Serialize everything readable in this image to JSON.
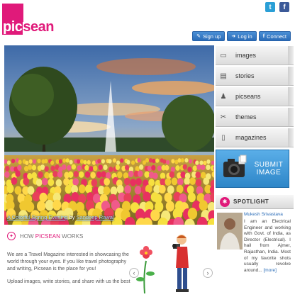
{
  "brand": {
    "logo_text": "picsean",
    "logo_prefix": "pic",
    "logo_suffix": "sean",
    "accent": "#e01a7a"
  },
  "social": {
    "twitter_icon": "twitter-icon",
    "facebook_icon": "facebook-icon",
    "twitter_glyph": "t",
    "facebook_glyph": "f"
  },
  "auth": {
    "signup": "Sign up",
    "login": "Log in",
    "connect": "Connect"
  },
  "hero": {
    "caption_title": "A Colorful Spring Evening",
    "caption_by": "by",
    "caption_author": "Sandeep Rawal"
  },
  "menu": [
    {
      "label": "images",
      "icon": "monitor-icon",
      "glyph": "▭"
    },
    {
      "label": "stories",
      "icon": "document-icon",
      "glyph": "▤"
    },
    {
      "label": "picseans",
      "icon": "person-icon",
      "glyph": "♟"
    },
    {
      "label": "themes",
      "icon": "scissors-icon",
      "glyph": "✂"
    },
    {
      "label": "magazines",
      "icon": "book-icon",
      "glyph": "▯"
    }
  ],
  "submit": {
    "line1": "SUBMIT",
    "line2": "IMAGE"
  },
  "spotlight": {
    "heading": "SPOTLIGHT",
    "name": "Mukesh Srivastava",
    "bio": "I am an Electrical Engineer and working with Govt. of India, as Director (Electrical). I hail from Ajmer, Rajasthan, India. Most of my favorite shots usually revolve around...",
    "more": "[more]"
  },
  "how": {
    "heading_prefix": "HOW",
    "heading_brand": "PICSEAN",
    "heading_suffix": "WORKS",
    "p1": "We are a Travel Magazine interested in showcasing the world through your eyes. If you like travel photography and writing, Picsean is the place for you!",
    "p2": "Upload images, write stories, and share with us the best"
  }
}
